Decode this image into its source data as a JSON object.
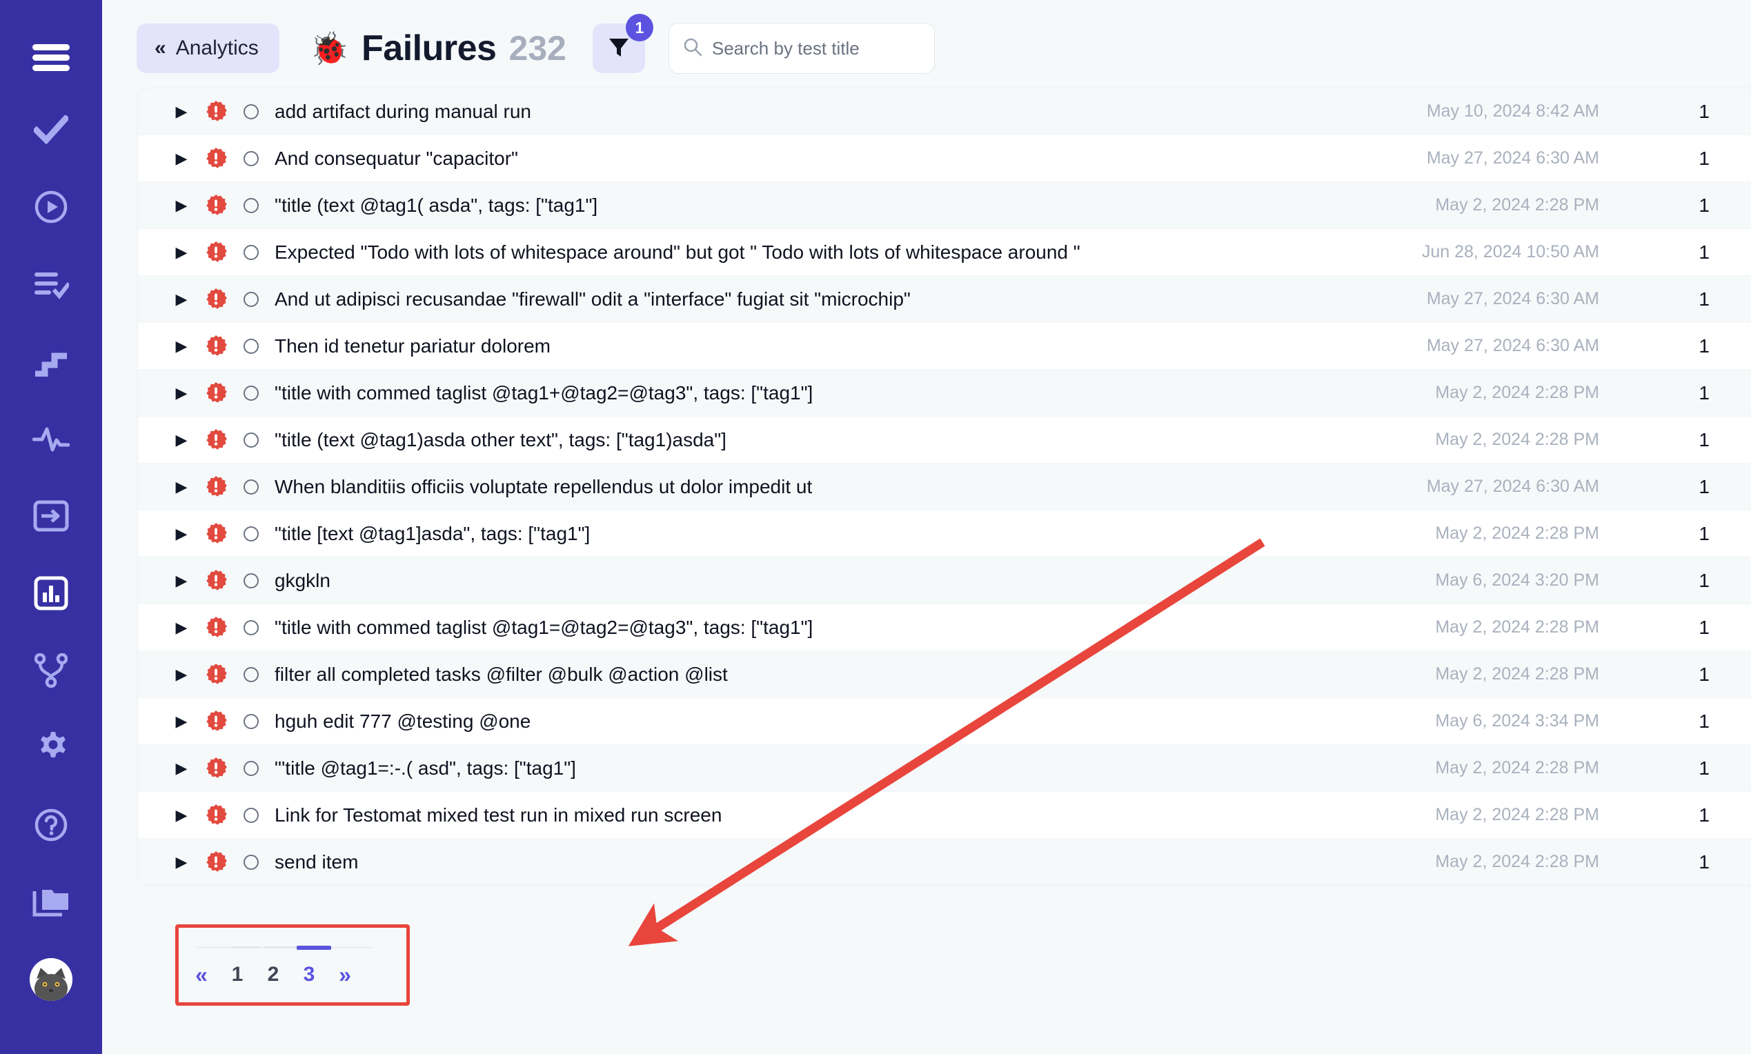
{
  "accent": {
    "sidebar_bg": "#3730a3",
    "brand_purple": "#5b53e0",
    "chip_bg": "#e3e4fb",
    "row_alt_bg": "#f6f9fa",
    "error_red": "#e24a3f",
    "annotation_red": "#e8453c"
  },
  "sidebar": {
    "items": [
      {
        "icon": "menu-icon",
        "label": "Menu",
        "active": false
      },
      {
        "icon": "check-icon",
        "label": "Tests",
        "active": false
      },
      {
        "icon": "play-circle-icon",
        "label": "Runs",
        "active": false
      },
      {
        "icon": "list-check-icon",
        "label": "Plans",
        "active": false
      },
      {
        "icon": "stairs-icon",
        "label": "Steps",
        "active": false
      },
      {
        "icon": "pulse-icon",
        "label": "Activity",
        "active": false
      },
      {
        "icon": "login-box-icon",
        "label": "Import",
        "active": false
      },
      {
        "icon": "bar-chart-box-icon",
        "label": "Analytics",
        "active": true
      },
      {
        "icon": "git-branch-icon",
        "label": "Branches",
        "active": false
      },
      {
        "icon": "gear-icon",
        "label": "Settings",
        "active": false
      },
      {
        "icon": "question-circle-icon",
        "label": "Help",
        "active": false
      },
      {
        "icon": "folders-icon",
        "label": "Projects",
        "active": false
      }
    ],
    "avatar": {
      "icon": "user-avatar-cat",
      "label": "Account"
    }
  },
  "header": {
    "back_label": "Analytics",
    "back_icon": "double-chevron-left-icon",
    "title_emoji": "🐞",
    "title": "Failures",
    "count": "232",
    "filter_icon": "funnel-icon",
    "filter_badge": "1",
    "search_icon": "search-icon",
    "search_placeholder": "Search by test title",
    "search_value": ""
  },
  "table": {
    "row_status_icon": "error-badge-icon",
    "row_expand_icon": "caret-right-icon",
    "row_state_icon": "circle-outline-icon",
    "rows": [
      {
        "title": "add artifact during manual run",
        "date": "May 10, 2024 8:42 AM",
        "count": "1"
      },
      {
        "title": "And consequatur \"capacitor\"",
        "date": "May 27, 2024 6:30 AM",
        "count": "1"
      },
      {
        "title": "\"title (text @tag1( asda\", tags: [\"tag1\"]",
        "date": "May 2, 2024 2:28 PM",
        "count": "1"
      },
      {
        "title": "Expected \"Todo with lots of whitespace around\" but got \" Todo with lots of whitespace around \"",
        "date": "Jun 28, 2024 10:50 AM",
        "count": "1"
      },
      {
        "title": "And ut adipisci recusandae \"firewall\" odit a \"interface\" fugiat sit \"microchip\"",
        "date": "May 27, 2024 6:30 AM",
        "count": "1"
      },
      {
        "title": "Then id tenetur pariatur dolorem",
        "date": "May 27, 2024 6:30 AM",
        "count": "1"
      },
      {
        "title": "\"title with commed taglist @tag1+@tag2=@tag3\", tags: [\"tag1\"]",
        "date": "May 2, 2024 2:28 PM",
        "count": "1"
      },
      {
        "title": "\"title (text @tag1)asda other text\", tags: [\"tag1)asda\"]",
        "date": "May 2, 2024 2:28 PM",
        "count": "1"
      },
      {
        "title": "When blanditiis officiis voluptate repellendus ut dolor impedit ut",
        "date": "May 27, 2024 6:30 AM",
        "count": "1"
      },
      {
        "title": "\"title [text @tag1]asda\", tags: [\"tag1\"]",
        "date": "May 2, 2024 2:28 PM",
        "count": "1"
      },
      {
        "title": "gkgkln",
        "date": "May 6, 2024 3:20 PM",
        "count": "1"
      },
      {
        "title": "\"title with commed taglist @tag1=@tag2=@tag3\", tags: [\"tag1\"]",
        "date": "May 2, 2024 2:28 PM",
        "count": "1"
      },
      {
        "title": "filter all completed tasks @filter @bulk @action @list",
        "date": "May 2, 2024 2:28 PM",
        "count": "1"
      },
      {
        "title": "hguh edit 777 @testing @one",
        "date": "May 6, 2024 3:34 PM",
        "count": "1"
      },
      {
        "title": "\"'title @tag1=:-.( asd\", tags: [\"tag1\"]",
        "date": "May 2, 2024 2:28 PM",
        "count": "1"
      },
      {
        "title": "Link for Testomat mixed test run in mixed run screen",
        "date": "May 2, 2024 2:28 PM",
        "count": "1"
      },
      {
        "title": "send item",
        "date": "May 2, 2024 2:28 PM",
        "count": "1"
      }
    ]
  },
  "pagination": {
    "prev_label": "«",
    "next_label": "»",
    "pages": [
      "1",
      "2",
      "3"
    ],
    "active_page": "3"
  },
  "annotation": {
    "arrow_label": "red-arrow-pointing-to-pagination",
    "highlight_label": "red-rectangle-around-pagination"
  }
}
